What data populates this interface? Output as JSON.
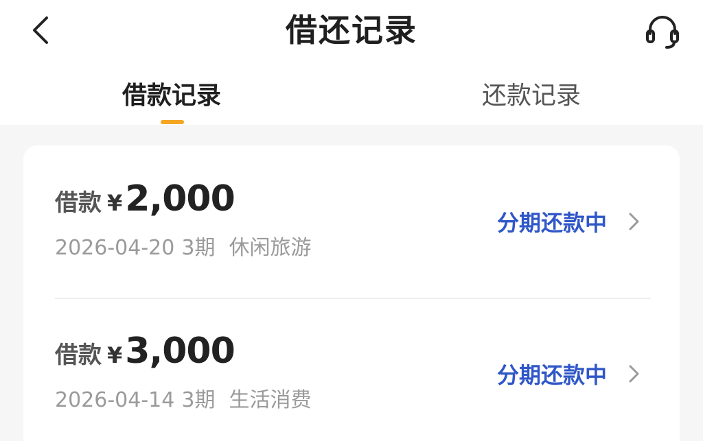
{
  "header": {
    "title": "借还记录",
    "back_icon": "chevron-left-icon",
    "support_icon": "headset-icon"
  },
  "tabs": [
    {
      "label": "借款记录",
      "active": true
    },
    {
      "label": "还款记录",
      "active": false
    }
  ],
  "colors": {
    "accent": "#f5a623",
    "status": "#2f57c8"
  },
  "records": [
    {
      "label": "借款",
      "currency": "¥",
      "amount": "2,000",
      "date": "2026-04-20",
      "term": "3期",
      "purpose": "休闲旅游",
      "status": "分期还款中"
    },
    {
      "label": "借款",
      "currency": "¥",
      "amount": "3,000",
      "date": "2026-04-14",
      "term": "3期",
      "purpose": "生活消费",
      "status": "分期还款中"
    }
  ]
}
